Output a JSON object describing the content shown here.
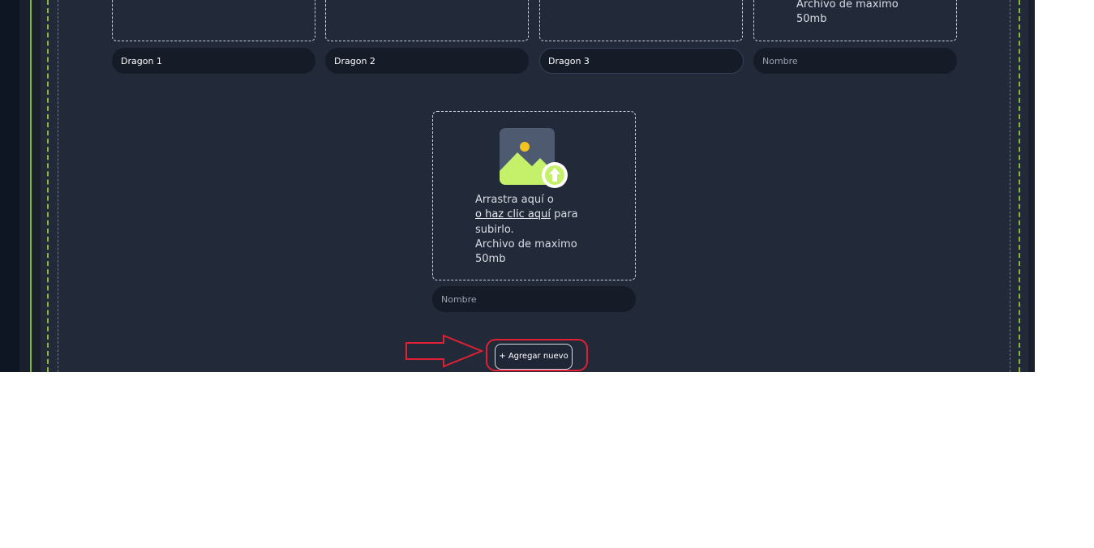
{
  "uploads": [
    {
      "name_value": "Dragon 1",
      "name_placeholder": "Nombre",
      "focused": false
    },
    {
      "name_value": "Dragon 2",
      "name_placeholder": "Nombre",
      "focused": false
    },
    {
      "name_value": "Dragon 3",
      "name_placeholder": "Nombre",
      "focused": true
    },
    {
      "name_value": "",
      "name_placeholder": "Nombre",
      "focused": false,
      "hint_line_4": "Archivo de maximo",
      "hint_line_5": "50mb"
    }
  ],
  "new_upload": {
    "hint_line_1": "Arrastra aquí o",
    "hint_link": "o haz clic aquí",
    "hint_after_link": " para",
    "hint_line_3": "subirlo.",
    "hint_line_4": "Archivo de maximo",
    "hint_line_5": "50mb",
    "name_value": "",
    "name_placeholder": "Nombre"
  },
  "add_button": {
    "label": "+ Agregar nuevo"
  },
  "colors": {
    "accent_red": "#e02c3c",
    "upload_green": "#c4f06a",
    "panel_bg": "#222938"
  },
  "icons": {
    "upload": "image-upload-icon",
    "arrow": "red-arrow-annotation"
  }
}
